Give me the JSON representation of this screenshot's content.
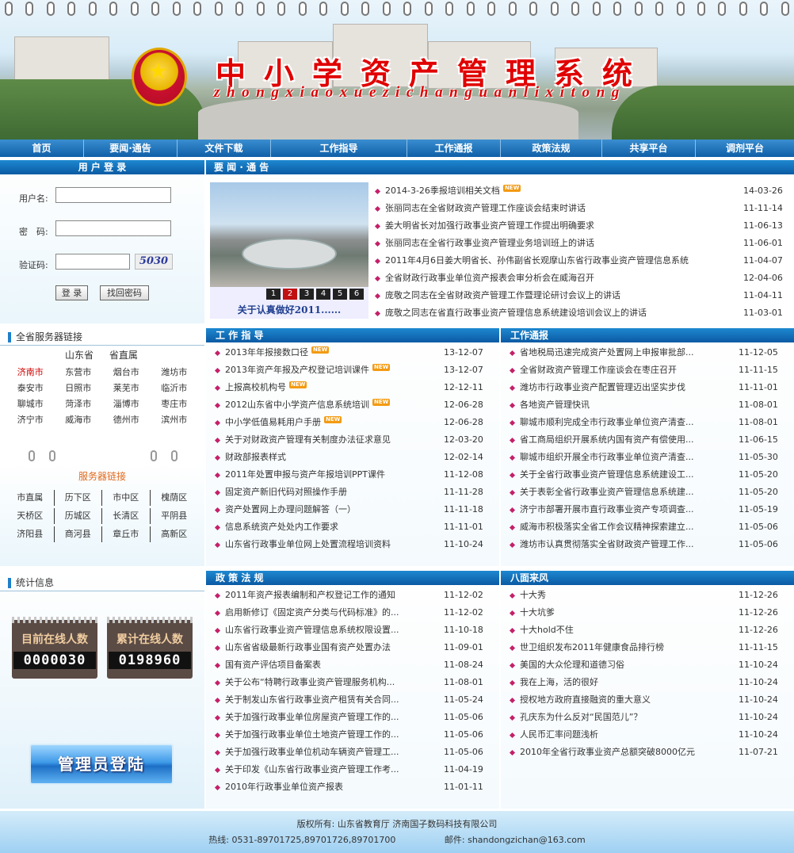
{
  "banner": {
    "title": "中小学资产管理系统",
    "pinyin": "zhongxiaoxuezichanguanlixitong",
    "emblem_icon": "national-emblem"
  },
  "nav": [
    "首页",
    "要闻·通告",
    "文件下载",
    "工作指导",
    "工作通报",
    "政策法规",
    "共享平台",
    "调剂平台"
  ],
  "login": {
    "title": "用 户 登 录",
    "user_label": "用户名:",
    "pass_label": "密　码:",
    "code_label": "验证码:",
    "captcha": "5030",
    "login_btn": "登 录",
    "recover_btn": "找回密码"
  },
  "province": {
    "title": "全省服务器链接",
    "head": [
      "山东省",
      "省直属"
    ],
    "cities": [
      "济南市",
      "东营市",
      "烟台市",
      "潍坊市",
      "泰安市",
      "日照市",
      "莱芜市",
      "临沂市",
      "聊城市",
      "菏泽市",
      "淄博市",
      "枣庄市",
      "济宁市",
      "威海市",
      "德州市",
      "滨州市"
    ],
    "highlight_color": "#d00000"
  },
  "servers": {
    "title": "服务器链接",
    "items": [
      "市直属",
      "历下区",
      "市中区",
      "槐荫区",
      "天桥区",
      "历城区",
      "长清区",
      "平阴县",
      "济阳县",
      "商河县",
      "章丘市",
      "高新区"
    ]
  },
  "stats": {
    "title": "统计信息",
    "current_label": "目前在线人数",
    "current_value": "0000030",
    "total_label": "累计在线人数",
    "total_value": "0198960"
  },
  "admin": {
    "label": "管理员登陆"
  },
  "news": {
    "title": "要 闻 · 通 告",
    "photo_caption": "关于认真做好2011......",
    "pages": [
      "1",
      "2",
      "3",
      "4",
      "5",
      "6"
    ],
    "active_page": "2",
    "items": [
      {
        "t": "2014-3-26季报培训相关文档",
        "d": "14-03-26",
        "new": true
      },
      {
        "t": "张丽同志在全省财政资产管理工作座谈会结束时讲话",
        "d": "11-11-14",
        "new": false
      },
      {
        "t": "姜大明省长对加强行政事业资产管理工作提出明确要求",
        "d": "11-06-13",
        "new": false
      },
      {
        "t": "张丽同志在全省行政事业资产管理业务培训班上的讲话",
        "d": "11-06-01",
        "new": false
      },
      {
        "t": "2011年4月6日姜大明省长、孙伟副省长观摩山东省行政事业资产管理信息系统",
        "d": "11-04-07",
        "new": false
      },
      {
        "t": "全省财政行政事业单位资产报表会审分析会在威海召开",
        "d": "12-04-06",
        "new": false
      },
      {
        "t": "庞敬之同志在全省财政资产管理工作暨理论研讨会议上的讲话",
        "d": "11-04-11",
        "new": false
      },
      {
        "t": "庞敬之同志在省直行政事业资产管理信息系统建设培训会议上的讲话",
        "d": "11-03-01",
        "new": false
      }
    ]
  },
  "guide": {
    "title": "工 作 指 导",
    "items": [
      {
        "t": "2013年年报接数口径",
        "d": "13-12-07",
        "new": true
      },
      {
        "t": "2013年资产年报及产权登记培训课件",
        "d": "13-12-07",
        "new": true
      },
      {
        "t": "上报高校机构号",
        "d": "12-12-11",
        "new": true
      },
      {
        "t": "2012山东省中小学资产信息系统培训",
        "d": "12-06-28",
        "new": true
      },
      {
        "t": "中小学低值易耗用户手册",
        "d": "12-06-28",
        "new": true
      },
      {
        "t": "关于对财政资产管理有关制度办法征求意见",
        "d": "12-03-20",
        "new": false
      },
      {
        "t": "财政部报表样式",
        "d": "12-02-14",
        "new": false
      },
      {
        "t": "2011年处置申报与资产年报培训PPT课件",
        "d": "11-12-08",
        "new": false
      },
      {
        "t": "固定资产新旧代码对照操作手册",
        "d": "11-11-28",
        "new": false
      },
      {
        "t": "资产处置网上办理问题解答（一）",
        "d": "11-11-18",
        "new": false
      },
      {
        "t": "信息系统资产处处内工作要求",
        "d": "11-11-01",
        "new": false
      },
      {
        "t": "山东省行政事业单位网上处置流程培训资料",
        "d": "11-10-24",
        "new": false
      }
    ]
  },
  "report": {
    "title": "工作通报",
    "items": [
      {
        "t": "省地税局迅速完成资产处置网上申报审批部...",
        "d": "11-12-05"
      },
      {
        "t": "全省财政资产管理工作座谈会在枣庄召开",
        "d": "11-11-15"
      },
      {
        "t": "潍坊市行政事业资产配置管理迈出坚实步伐",
        "d": "11-11-01"
      },
      {
        "t": "各地资产管理快讯",
        "d": "11-08-01"
      },
      {
        "t": "聊城市顺利完成全市行政事业单位资产清查...",
        "d": "11-08-01"
      },
      {
        "t": "省工商局组织开展系统内国有资产有偿使用...",
        "d": "11-06-15"
      },
      {
        "t": "聊城市组织开展全市行政事业单位资产清查...",
        "d": "11-05-30"
      },
      {
        "t": "关于全省行政事业资产管理信息系统建设工...",
        "d": "11-05-20"
      },
      {
        "t": "关于表彰全省行政事业资产管理信息系统建...",
        "d": "11-05-20"
      },
      {
        "t": "济宁市部署开展市直行政事业资产专项调查...",
        "d": "11-05-19"
      },
      {
        "t": "威海市积极落实全省工作会议精神探索建立...",
        "d": "11-05-06"
      },
      {
        "t": "潍坊市认真贯彻落实全省财政资产管理工作...",
        "d": "11-05-06"
      }
    ]
  },
  "policy": {
    "title": "政 策 法 规",
    "items": [
      {
        "t": "2011年资产报表编制和产权登记工作的通知",
        "d": "11-12-02"
      },
      {
        "t": "启用新修订《固定资产分类与代码标准》的...",
        "d": "11-12-02"
      },
      {
        "t": "山东省行政事业资产管理信息系统权限设置...",
        "d": "11-10-18"
      },
      {
        "t": "山东省省级最新行政事业国有资产处置办法",
        "d": "11-09-01"
      },
      {
        "t": "国有资产评估项目备案表",
        "d": "11-08-24"
      },
      {
        "t": "关于公布“特聘行政事业资产管理服务机构...",
        "d": "11-08-01"
      },
      {
        "t": "关于制发山东省行政事业资产租赁有关合同...",
        "d": "11-05-24"
      },
      {
        "t": "关于加强行政事业单位房屋资产管理工作的...",
        "d": "11-05-06"
      },
      {
        "t": "关于加强行政事业单位土地资产管理工作的...",
        "d": "11-05-06"
      },
      {
        "t": "关于加强行政事业单位机动车辆资产管理工...",
        "d": "11-05-06"
      },
      {
        "t": "关于印发《山东省行政事业资产管理工作考...",
        "d": "11-04-19"
      },
      {
        "t": "2010年行政事业单位资产报表",
        "d": "11-01-11"
      }
    ]
  },
  "winds": {
    "title": "八面来风",
    "items": [
      {
        "t": "十大秀",
        "d": "11-12-26"
      },
      {
        "t": "十大坑爹",
        "d": "11-12-26"
      },
      {
        "t": "十大hold不住",
        "d": "11-12-26"
      },
      {
        "t": "世卫组织发布2011年健康食品排行榜",
        "d": "11-11-15"
      },
      {
        "t": "美国的大众伦理和道德习俗",
        "d": "11-10-24"
      },
      {
        "t": "我在上海，活的很好",
        "d": "11-10-24"
      },
      {
        "t": "授权地方政府直接融资的重大意义",
        "d": "11-10-24"
      },
      {
        "t": "孔庆东为什么反对“民国范儿”？",
        "d": "11-10-24"
      },
      {
        "t": "人民币汇率问题浅析",
        "d": "11-10-24"
      },
      {
        "t": "2010年全省行政事业资产总额突破8000亿元",
        "d": "11-07-21"
      }
    ]
  },
  "footer": {
    "line1": "版权所有: 山东省教育厅   济南国子数码科技有限公司",
    "phone": "热线: 0531-89701725,89701726,89701700",
    "mail": "邮件: shandongzichan@163.com"
  }
}
